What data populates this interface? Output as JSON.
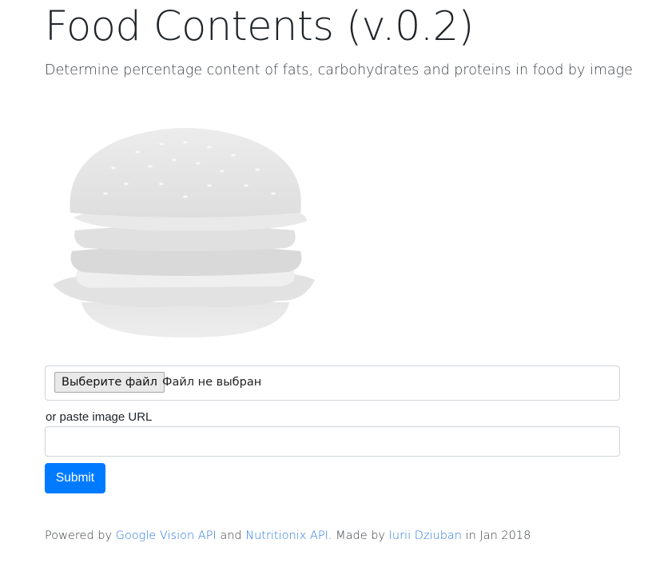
{
  "header": {
    "title": "Food Contents (v.0.2)",
    "subtitle": "Determine percentage content of fats, carbohydrates and proteins in food by image"
  },
  "hero_image": {
    "icon": "burger-image"
  },
  "upload": {
    "file_button_label": "Выберите файл",
    "file_status": "Файл не выбран",
    "url_label": "or paste image URL",
    "url_value": "",
    "url_placeholder": "",
    "submit_label": "Submit"
  },
  "footer": {
    "powered_by": "Powered by",
    "link_google": "Google Vision API",
    "and": "and",
    "link_nutritionix": "Nutritionix API",
    "made_by": ". Made by",
    "link_author": "Iurii Dziuban",
    "date": "in Jan 2018"
  },
  "colors": {
    "accent": "#007bff",
    "link": "#2a7ae2",
    "border": "#ced4da"
  }
}
